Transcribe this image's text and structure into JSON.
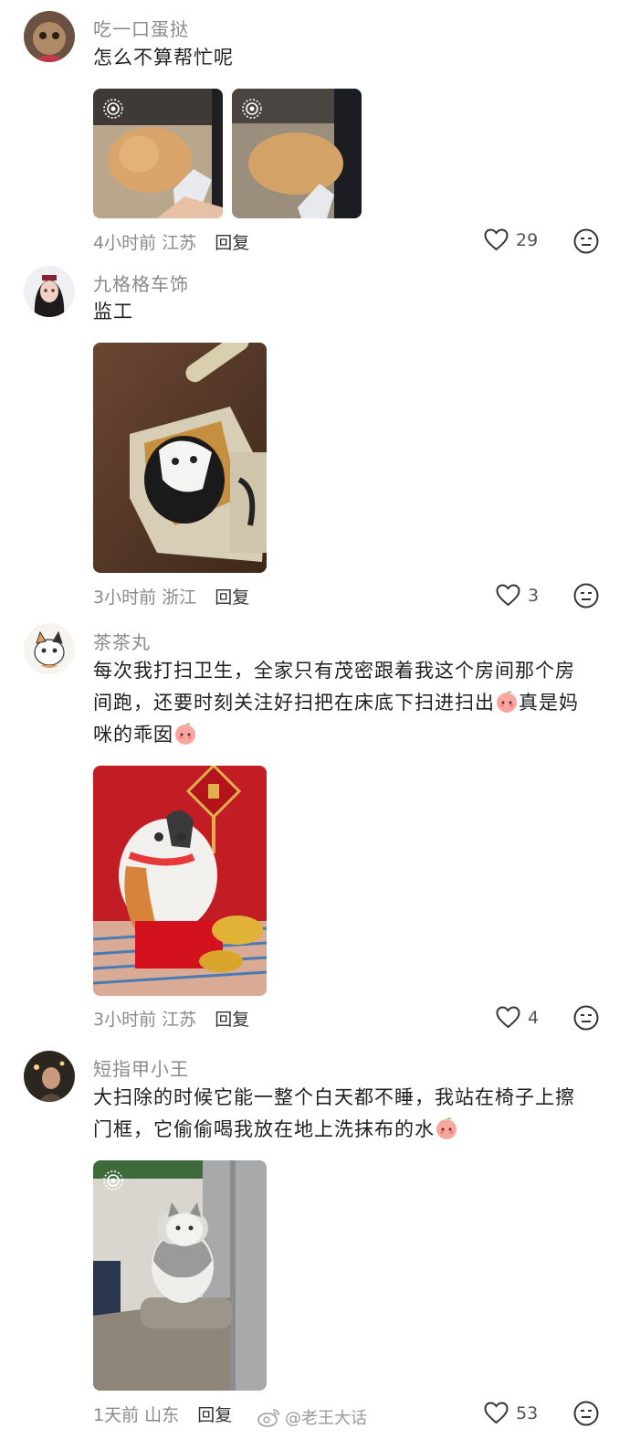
{
  "comments": [
    {
      "username": "吃一口蛋挞",
      "text": "怎么不算帮忙呢",
      "time": "4小时前",
      "location": "江苏",
      "reply_label": "回复",
      "likes": "29"
    },
    {
      "username": "九格格车饰",
      "text": "监工",
      "time": "3小时前",
      "location": "浙江",
      "reply_label": "回复",
      "likes": "3"
    },
    {
      "username": "茶茶丸",
      "text_line1": "每次我打扫卫生，全家只有茂密跟着我这个房间那个房",
      "text_line2": "间跑，还要时刻关注好扫把在床底下扫进扫出",
      "text_line2b": "真是妈",
      "text_line3": "咪的乖囡",
      "time": "3小时前",
      "location": "江苏",
      "reply_label": "回复",
      "likes": "4"
    },
    {
      "username": "短指甲小王",
      "text_line1": "大扫除的时候它能一整个白天都不睡，我站在椅子上擦",
      "text_line2": "门框，它偷偷喝我放在地上洗抹布的水",
      "time": "1天前",
      "location": "山东",
      "reply_label": "回复",
      "likes": "53"
    }
  ],
  "watermark": "@老王大话",
  "icons": {
    "like": "heart-outline-icon",
    "more": "neutral-face-icon",
    "live": "live-photo-icon",
    "emoji": "peach-emoji-icon"
  }
}
